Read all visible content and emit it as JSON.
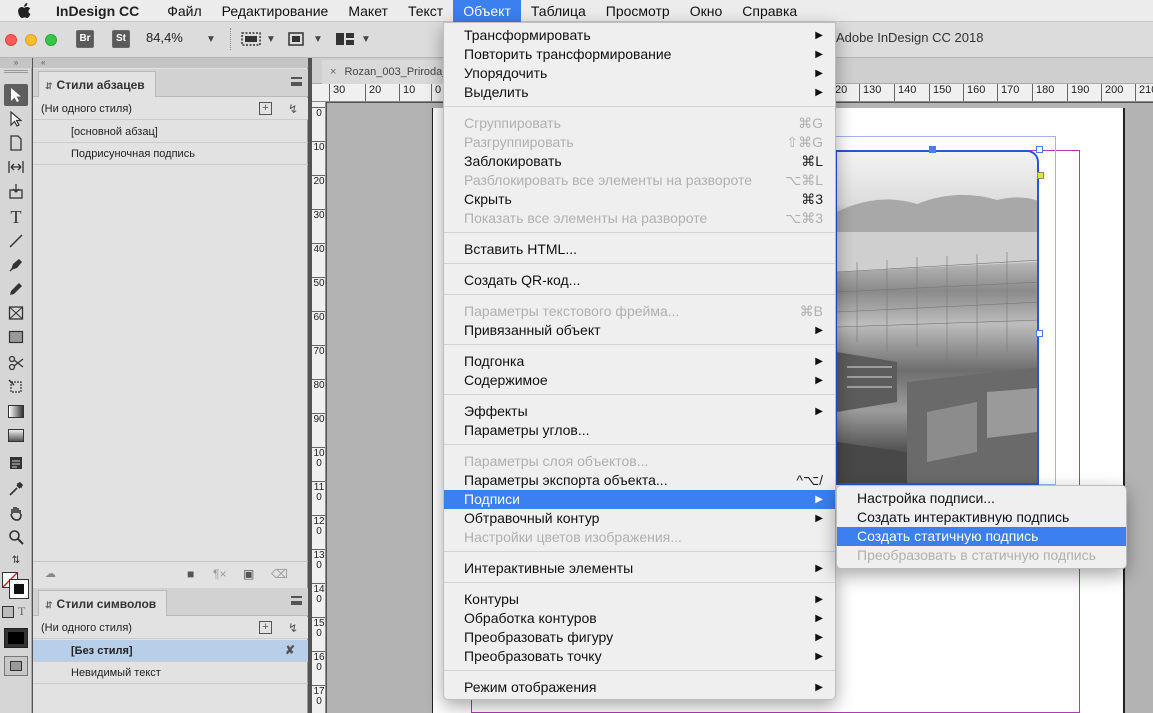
{
  "menubar": {
    "app_name": "InDesign CC",
    "items": [
      "Файл",
      "Редактирование",
      "Макет",
      "Текст",
      "Объект",
      "Таблица",
      "Просмотр",
      "Окно",
      "Справка"
    ]
  },
  "toolbar": {
    "br_label": "Br",
    "st_label": "St",
    "zoom": "84,4%",
    "window_title": "Adobe InDesign CC 2018"
  },
  "document": {
    "tab_label": "Rozan_003_Priroda_"
  },
  "paragraph_styles": {
    "title": "Стили абзацев",
    "items": [
      "(Ни одного стиля)",
      "[основной абзац]",
      "Подрисуночная подпись"
    ]
  },
  "character_styles": {
    "title": "Стили символов",
    "items": [
      "(Ни одного стиля)",
      "[Без стиля]",
      "Невидимый текст"
    ]
  },
  "ruler_h": [
    "30",
    "20",
    "10",
    "0",
    "20",
    "130",
    "140",
    "150",
    "160",
    "170",
    "180",
    "190",
    "200",
    "210"
  ],
  "ruler_v": [
    "0",
    "10",
    "20",
    "30",
    "40",
    "50",
    "60",
    "70",
    "80",
    "90",
    "100",
    "110",
    "120",
    "130",
    "140",
    "150",
    "160",
    "170"
  ],
  "object_menu": {
    "items": [
      {
        "label": "Трансформировать",
        "shortcut": "",
        "submenu": true,
        "disabled": false
      },
      {
        "label": "Повторить трансформирование",
        "shortcut": "",
        "submenu": true,
        "disabled": false
      },
      {
        "label": "Упорядочить",
        "shortcut": "",
        "submenu": true,
        "disabled": false
      },
      {
        "label": "Выделить",
        "shortcut": "",
        "submenu": true,
        "disabled": false
      },
      {
        "label": "Сгруппировать",
        "shortcut": "⌘G",
        "submenu": false,
        "disabled": true
      },
      {
        "label": "Разгруппировать",
        "shortcut": "⇧⌘G",
        "submenu": false,
        "disabled": true
      },
      {
        "label": "Заблокировать",
        "shortcut": "⌘L",
        "submenu": false,
        "disabled": false
      },
      {
        "label": "Разблокировать все элементы на развороте",
        "shortcut": "⌥⌘L",
        "submenu": false,
        "disabled": true
      },
      {
        "label": "Скрыть",
        "shortcut": "⌘3",
        "submenu": false,
        "disabled": false
      },
      {
        "label": "Показать все элементы на развороте",
        "shortcut": "⌥⌘3",
        "submenu": false,
        "disabled": true
      },
      {
        "label": "Вставить HTML...",
        "shortcut": "",
        "submenu": false,
        "disabled": false
      },
      {
        "label": "Создать QR-код...",
        "shortcut": "",
        "submenu": false,
        "disabled": false
      },
      {
        "label": "Параметры текстового фрейма...",
        "shortcut": "⌘B",
        "submenu": false,
        "disabled": true
      },
      {
        "label": "Привязанный объект",
        "shortcut": "",
        "submenu": true,
        "disabled": false
      },
      {
        "label": "Подгонка",
        "shortcut": "",
        "submenu": true,
        "disabled": false
      },
      {
        "label": "Содержимое",
        "shortcut": "",
        "submenu": true,
        "disabled": false
      },
      {
        "label": "Эффекты",
        "shortcut": "",
        "submenu": true,
        "disabled": false
      },
      {
        "label": "Параметры углов...",
        "shortcut": "",
        "submenu": false,
        "disabled": false
      },
      {
        "label": "Параметры слоя объектов...",
        "shortcut": "",
        "submenu": false,
        "disabled": true
      },
      {
        "label": "Параметры экспорта объекта...",
        "shortcut": "^⌥/",
        "submenu": false,
        "disabled": false
      },
      {
        "label": "Подписи",
        "shortcut": "",
        "submenu": true,
        "disabled": false,
        "highlighted": true
      },
      {
        "label": "Обтравочный контур",
        "shortcut": "",
        "submenu": true,
        "disabled": false
      },
      {
        "label": "Настройки цветов изображения...",
        "shortcut": "",
        "submenu": false,
        "disabled": true
      },
      {
        "label": "Интерактивные элементы",
        "shortcut": "",
        "submenu": true,
        "disabled": false
      },
      {
        "label": "Контуры",
        "shortcut": "",
        "submenu": true,
        "disabled": false
      },
      {
        "label": "Обработка контуров",
        "shortcut": "",
        "submenu": true,
        "disabled": false
      },
      {
        "label": "Преобразовать фигуру",
        "shortcut": "",
        "submenu": true,
        "disabled": false
      },
      {
        "label": "Преобразовать точку",
        "shortcut": "",
        "submenu": true,
        "disabled": false
      },
      {
        "label": "Режим отображения",
        "shortcut": "",
        "submenu": true,
        "disabled": false
      }
    ]
  },
  "captions_submenu": {
    "items": [
      {
        "label": "Настройка подписи...",
        "disabled": false
      },
      {
        "label": "Создать интерактивную подпись",
        "disabled": false
      },
      {
        "label": "Создать статичную подпись",
        "disabled": false,
        "highlighted": true
      },
      {
        "label": "Преобразовать в статичную подпись",
        "disabled": true
      }
    ]
  },
  "colors": {
    "accent": "#3b7ff0",
    "selection_frame": "#2b55d6",
    "margin_guide": "#b03ab0"
  }
}
